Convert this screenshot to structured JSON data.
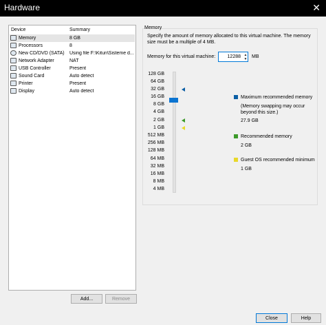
{
  "window": {
    "title": "Hardware",
    "close_glyph": "✕"
  },
  "devices": {
    "columns": [
      "Device",
      "Summary"
    ],
    "rows": [
      {
        "name": "Memory",
        "summary": "8 GB",
        "icon": "memory-icon",
        "selected": true
      },
      {
        "name": "Processors",
        "summary": "8",
        "icon": "processor-icon"
      },
      {
        "name": "New CD/DVD (SATA)",
        "summary": "Using file F:\\Kitun\\Sisteme d...",
        "icon": "cd-dvd-icon"
      },
      {
        "name": "Network Adapter",
        "summary": "NAT",
        "icon": "network-adapter-icon"
      },
      {
        "name": "USB Controller",
        "summary": "Present",
        "icon": "usb-controller-icon"
      },
      {
        "name": "Sound Card",
        "summary": "Auto detect",
        "icon": "sound-card-icon"
      },
      {
        "name": "Printer",
        "summary": "Present",
        "icon": "printer-icon"
      },
      {
        "name": "Display",
        "summary": "Auto detect",
        "icon": "display-icon"
      }
    ]
  },
  "buttons": {
    "add": "Add...",
    "remove": "Remove",
    "close": "Close",
    "help": "Help"
  },
  "memory": {
    "group_label": "Memory",
    "description": "Specify the amount of memory allocated to this virtual machine. The memory size must be a multiple of 4 MB.",
    "input_label": "Memory for this virtual machine:",
    "value": "12288",
    "unit": "MB",
    "spin_up": "▲",
    "spin_down": "▼",
    "scale": [
      "128 GB",
      "64 GB",
      "32 GB",
      "16 GB",
      "8 GB",
      "4 GB",
      "2 GB",
      "1 GB",
      "512 MB",
      "256 MB",
      "128 MB",
      "64 MB",
      "32 MB",
      "16 MB",
      "8 MB",
      "4 MB"
    ],
    "legend": {
      "max": {
        "title": "Maximum recommended memory",
        "note": "(Memory swapping may occur beyond this size.)",
        "value": "27.9 GB",
        "color": "#0b5fa5"
      },
      "recommended": {
        "title": "Recommended memory",
        "value": "2 GB",
        "color": "#3c9a2a"
      },
      "guest_min": {
        "title": "Guest OS recommended minimum",
        "value": "1 GB",
        "color": "#e8d82a"
      }
    }
  }
}
